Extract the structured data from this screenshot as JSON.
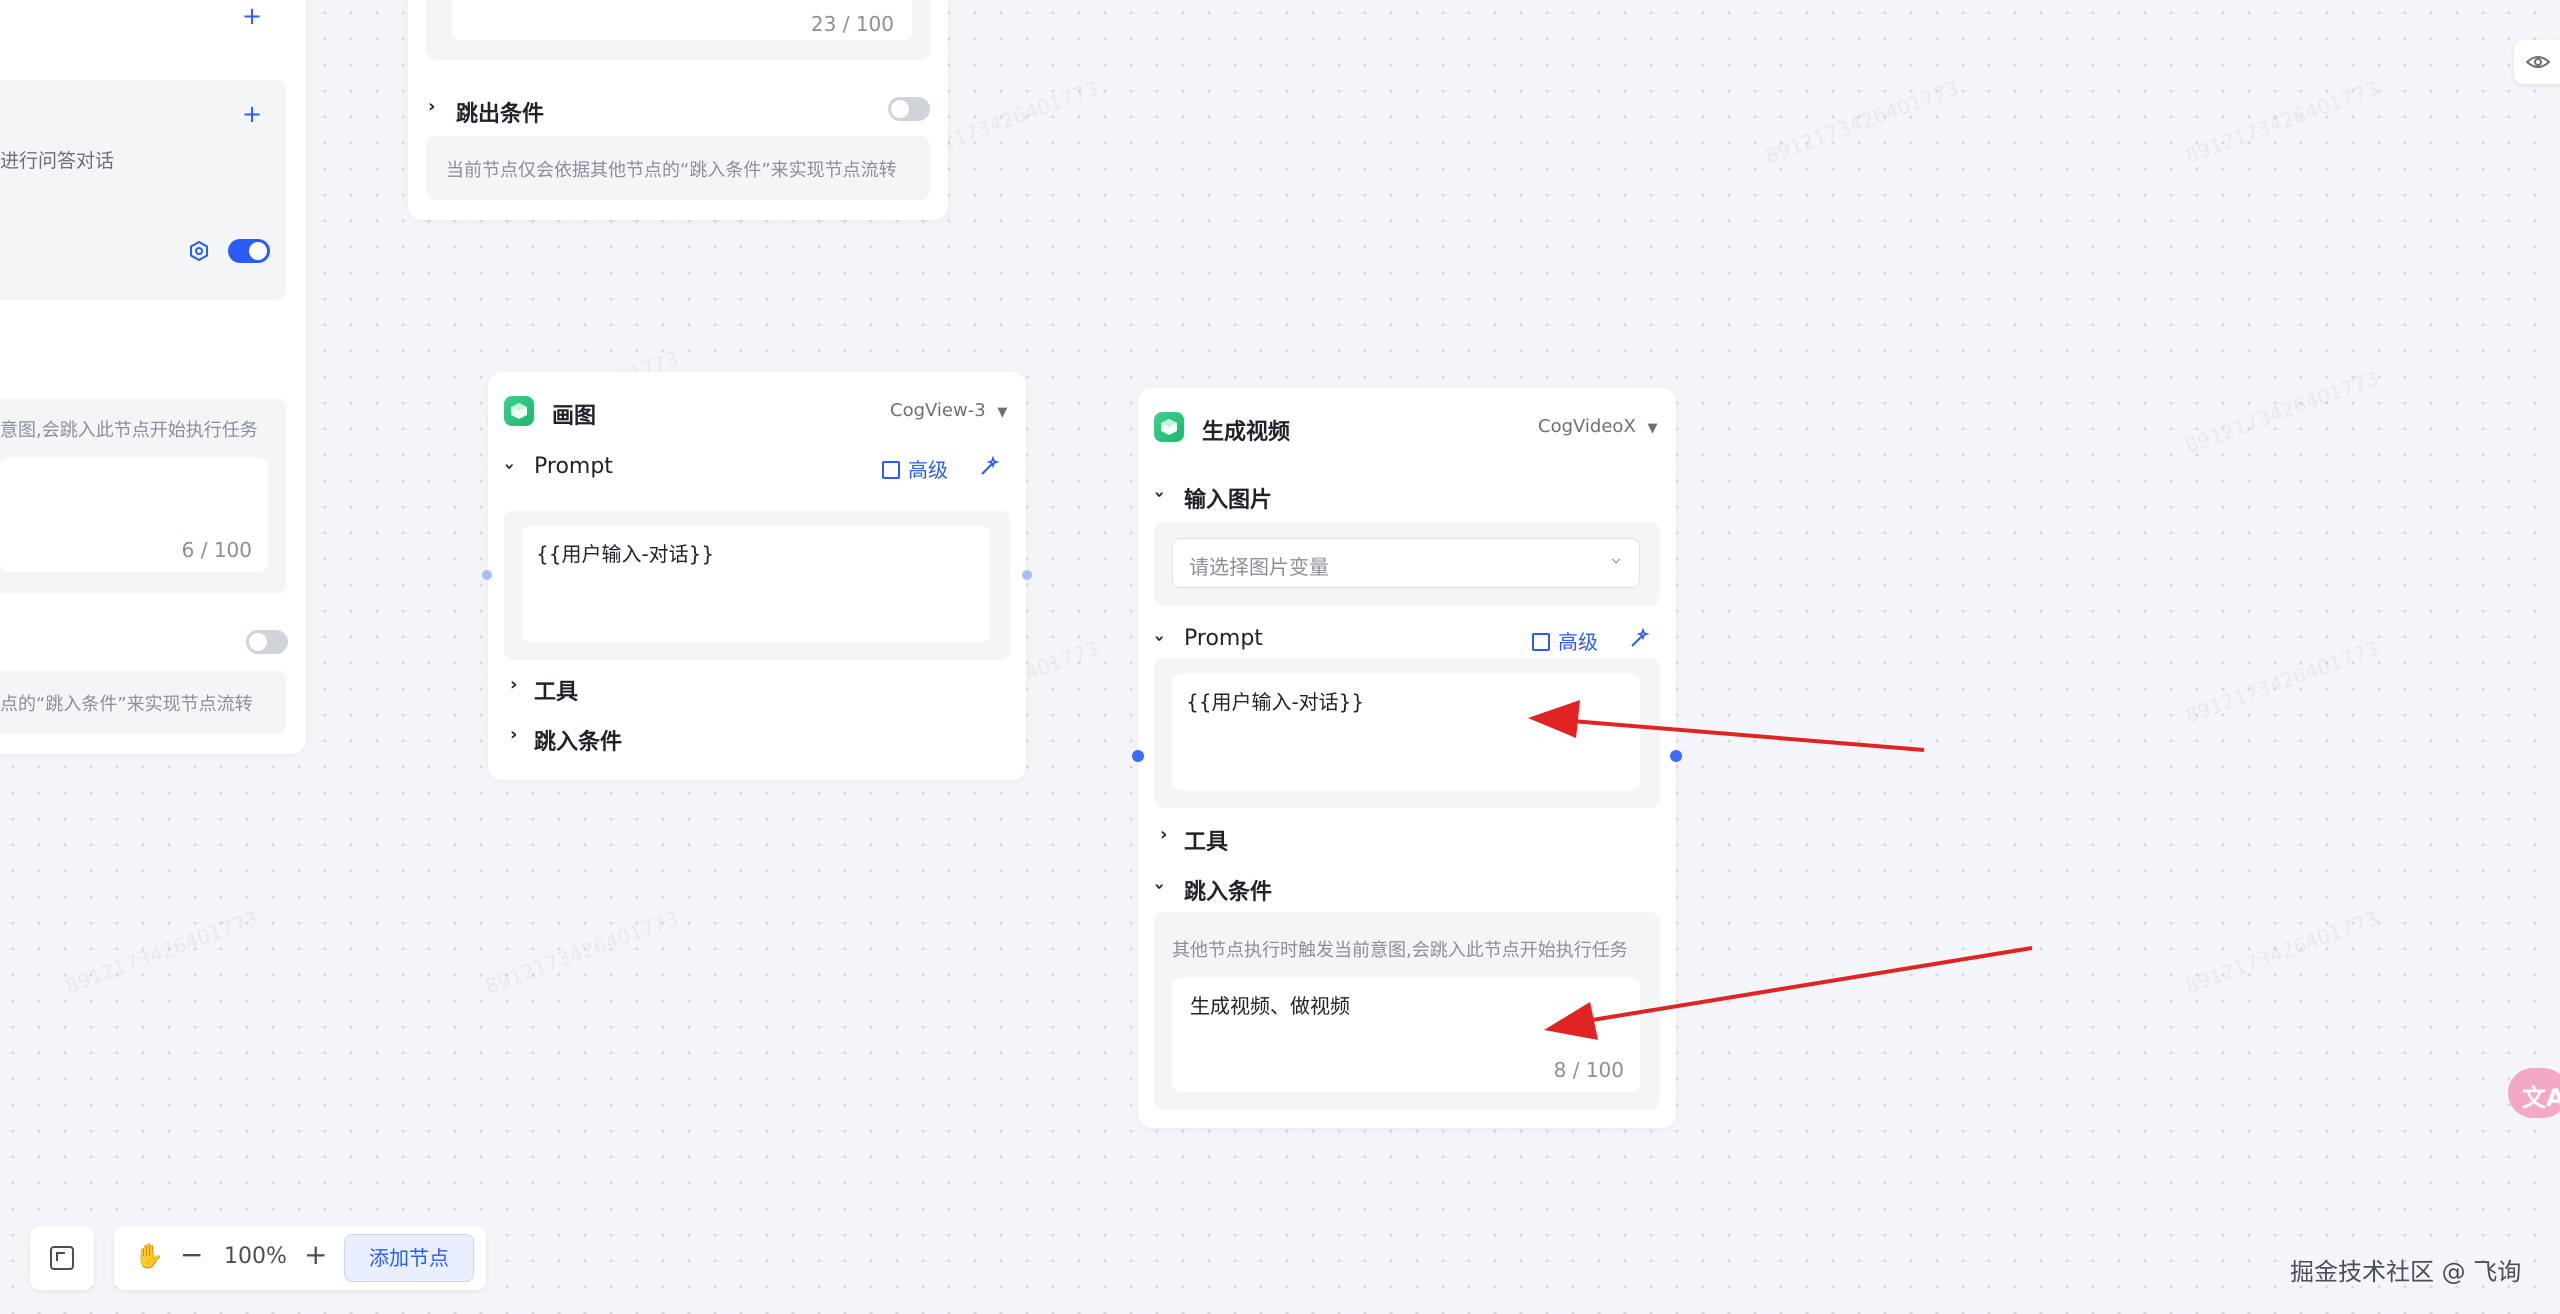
{
  "left_node": {
    "desc_fragment": "进行问答对话",
    "intent_desc_fragment": "意图,会跳入此节点开始执行任务",
    "counter": "6 / 100",
    "jump_out_desc_fragment": "点的“跳入条件”来实现节点流转"
  },
  "top_node": {
    "counter": "23 / 100",
    "jump_out_title": "跳出条件",
    "jump_out_desc": "当前节点仅会依据其他节点的“跳入条件”来实现节点流转"
  },
  "draw_node": {
    "title": "画图",
    "model": "CogView-3",
    "prompt_label": "Prompt",
    "advanced_label": "高级",
    "prompt_value": "{{用户输入-对话}}",
    "tools_label": "工具",
    "jump_in_label": "跳入条件"
  },
  "video_node": {
    "title": "生成视频",
    "model": "CogVideoX",
    "input_image_label": "输入图片",
    "image_select_placeholder": "请选择图片变量",
    "prompt_label": "Prompt",
    "advanced_label": "高级",
    "prompt_value": "{{用户输入-对话}}",
    "tools_label": "工具",
    "jump_in_label": "跳入条件",
    "jump_in_desc": "其他节点执行时触发当前意图,会跳入此节点开始执行任务",
    "jump_in_value": "生成视频、做视频",
    "counter": "8 / 100"
  },
  "toolbar": {
    "zoom": "100%",
    "add_node": "添加节点"
  },
  "footer": {
    "watermark_credit": "掘金技术社区 @ 飞询"
  },
  "watermark_text": "8912173426401773"
}
